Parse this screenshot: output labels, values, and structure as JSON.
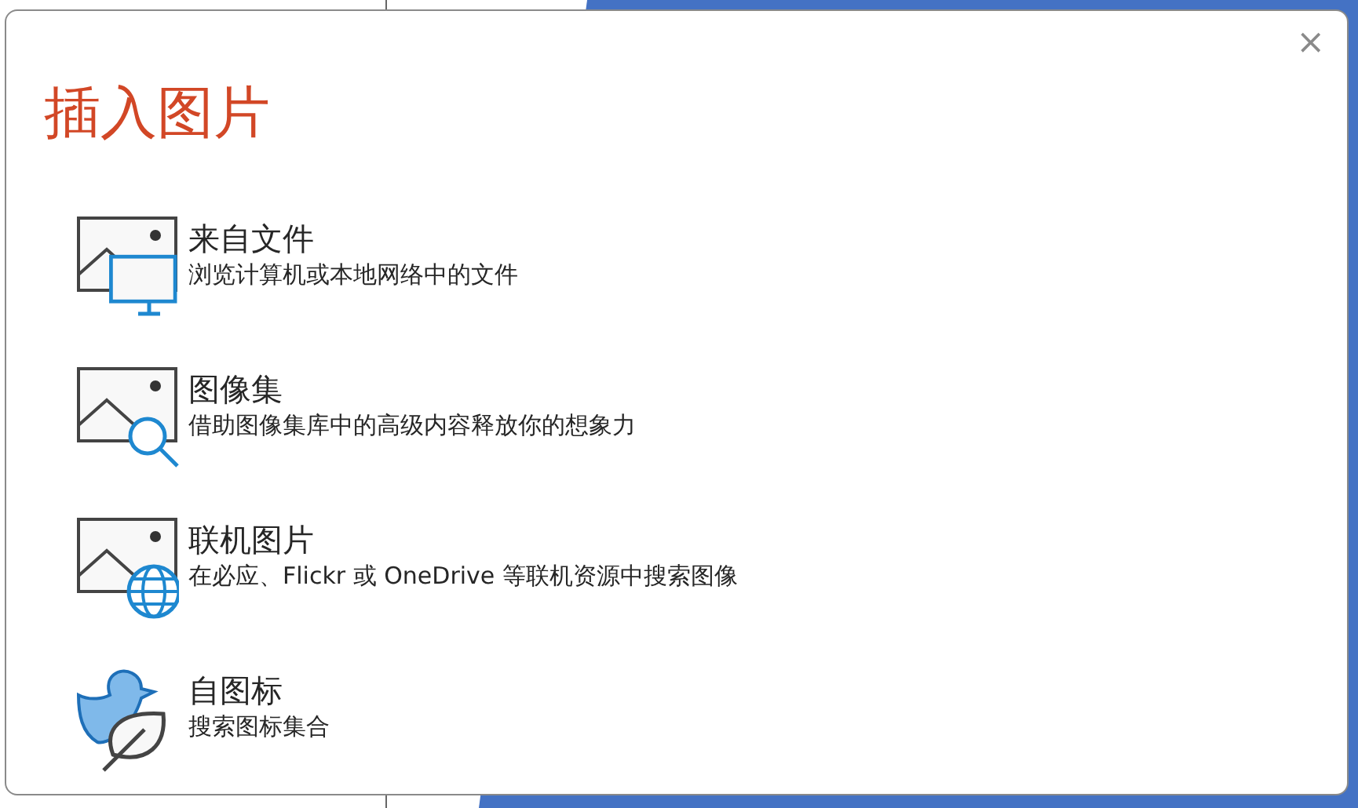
{
  "dialog": {
    "title": "插入图片",
    "close": "×",
    "options": [
      {
        "kind": "file",
        "title": "来自文件",
        "description": "浏览计算机或本地网络中的文件"
      },
      {
        "kind": "gallery",
        "title": "图像集",
        "description": "借助图像集库中的高级内容释放你的想象力"
      },
      {
        "kind": "online",
        "title": "联机图片",
        "description": "在必应、Flickr 或 OneDrive 等联机资源中搜索图像"
      },
      {
        "kind": "icons",
        "title": "自图标",
        "description": "搜索图标集合"
      }
    ]
  }
}
